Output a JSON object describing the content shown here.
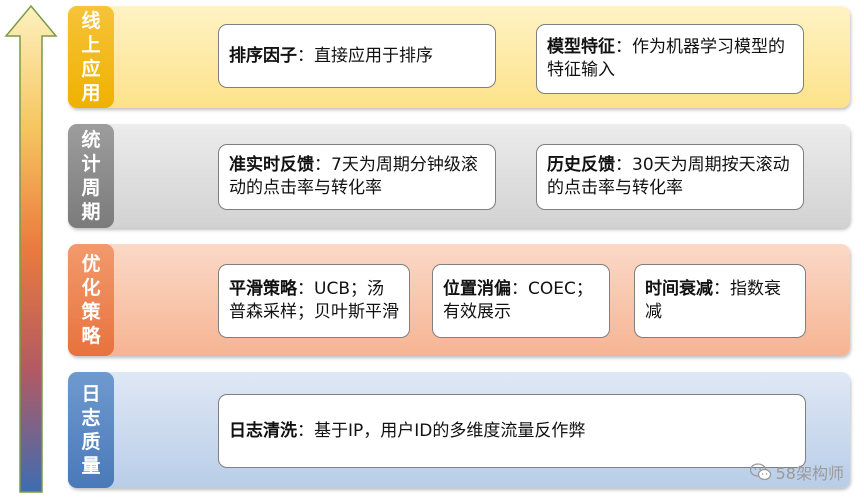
{
  "layers": [
    {
      "tag": "线上应用",
      "items": [
        {
          "title": "排序因子",
          "desc": "：直接应用于排序"
        },
        {
          "title": "模型特征",
          "desc": "：作为机器学习模型的特征输入"
        }
      ]
    },
    {
      "tag": "统计周期",
      "items": [
        {
          "title": "准实时反馈",
          "desc": "：7天为周期分钟级滚动的点击率与转化率"
        },
        {
          "title": "历史反馈",
          "desc": "：30天为周期按天滚动的点击率与转化率"
        }
      ]
    },
    {
      "tag": "优化策略",
      "items": [
        {
          "title": "平滑策略",
          "desc": "：UCB；汤普森采样；贝叶斯平滑"
        },
        {
          "title": "位置消偏",
          "desc": "：COEC；有效展示"
        },
        {
          "title": "时间衰减",
          "desc": "：指数衰减"
        }
      ]
    },
    {
      "tag": "日志质量",
      "items": [
        {
          "title": "日志清洗",
          "desc": "：基于IP，用户ID的多维度流量反作弊"
        }
      ]
    }
  ],
  "watermark": {
    "text": "58架构师",
    "icon": "wechat-icon"
  },
  "colors": {
    "arrow_top": "#fde9a0",
    "arrow_mid": "#e8733d",
    "arrow_bottom": "#3f6eb0"
  }
}
